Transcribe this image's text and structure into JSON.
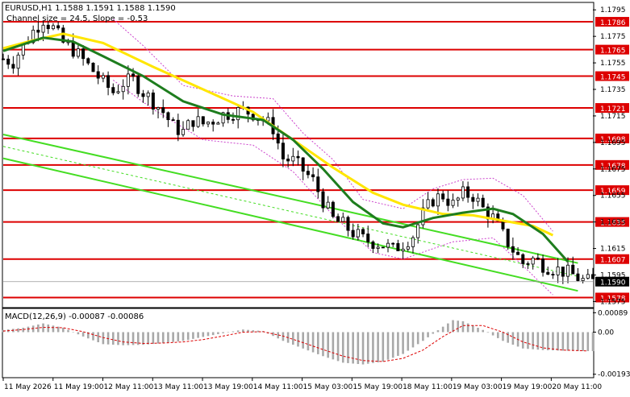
{
  "header": {
    "symbol_line": "EURUSD,H1  1.1588 1.1591 1.1588 1.1590",
    "channel_line": "Channel size = 24.5, Slope = -0.53"
  },
  "macd": {
    "label": "MACD(12,26,9) -0.00087 -0.00086",
    "ticks": [
      {
        "value": 0.00089,
        "label": "0.00089"
      },
      {
        "value": 0.0,
        "label": "0.00"
      },
      {
        "value": -0.00193,
        "label": "-0.00193"
      }
    ],
    "ylim": [
      -0.00205,
      0.00105
    ]
  },
  "price_axis": {
    "ylim": [
      1.1571,
      1.18
    ],
    "ticks": [
      {
        "value": 1.1795,
        "label": "1.1795"
      },
      {
        "value": 1.1775,
        "label": "1.1775"
      },
      {
        "value": 1.1755,
        "label": "1.1755"
      },
      {
        "value": 1.1735,
        "label": "1.1735"
      },
      {
        "value": 1.1715,
        "label": "1.1715"
      },
      {
        "value": 1.1695,
        "label": "1.1695"
      },
      {
        "value": 1.1675,
        "label": "1.1675"
      },
      {
        "value": 1.1655,
        "label": "1.1655"
      },
      {
        "value": 1.1635,
        "label": "1.1635"
      },
      {
        "value": 1.1615,
        "label": "1.1615"
      },
      {
        "value": 1.1595,
        "label": "1.1595"
      },
      {
        "value": 1.1575,
        "label": "1.1575"
      }
    ],
    "current_price": {
      "value": 1.159,
      "label": "1.1590"
    }
  },
  "time_axis": {
    "labels": [
      "11 May 2026",
      "11 May 19:00",
      "12 May 11:00",
      "13 May 11:00",
      "13 May 19:00",
      "14 May 11:00",
      "15 May 03:00",
      "15 May 19:00",
      "18 May 11:00",
      "19 May 03:00",
      "19 May 19:00",
      "20 May 11:00"
    ],
    "x_range": [
      0,
      118
    ]
  },
  "colors": {
    "level": "#dd0000",
    "candle": "#000000",
    "ma_fast": "#1e7d1e",
    "ma_slow": "#ffe600",
    "channel": "#44dd22",
    "envelope": "#cc44cc",
    "macd_hist": "#a8a8a8",
    "macd_signal": "#dd0000",
    "grid_text": "#000000"
  },
  "chart_data": {
    "type": "candlestick",
    "title": "EURUSD,H1",
    "horizontal_levels": [
      {
        "value": 1.1786,
        "label": "1.1786"
      },
      {
        "value": 1.1765,
        "label": "1.1765"
      },
      {
        "value": 1.1745,
        "label": "1.1745"
      },
      {
        "value": 1.1721,
        "label": "1.1721"
      },
      {
        "value": 1.1698,
        "label": "1.1698"
      },
      {
        "value": 1.1678,
        "label": "1.1678"
      },
      {
        "value": 1.1659,
        "label": "1.1659"
      },
      {
        "value": 1.1635,
        "label": "1.1635"
      },
      {
        "value": 1.1607,
        "label": "1.1607"
      },
      {
        "value": 1.1578,
        "label": "1.1578"
      }
    ],
    "close_path": [
      [
        0,
        1.1758
      ],
      [
        2,
        1.1756
      ],
      [
        4,
        1.1768
      ],
      [
        6,
        1.1779
      ],
      [
        8,
        1.1788
      ],
      [
        10,
        1.1781
      ],
      [
        12,
        1.177
      ],
      [
        14,
        1.1765
      ],
      [
        16,
        1.1757
      ],
      [
        18,
        1.1749
      ],
      [
        20,
        1.174
      ],
      [
        22,
        1.1733
      ],
      [
        24,
        1.174
      ],
      [
        26,
        1.1742
      ],
      [
        28,
        1.1733
      ],
      [
        30,
        1.1726
      ],
      [
        32,
        1.1718
      ],
      [
        34,
        1.1707
      ],
      [
        36,
        1.1703
      ],
      [
        38,
        1.1712
      ],
      [
        40,
        1.1709
      ],
      [
        42,
        1.1712
      ],
      [
        44,
        1.1716
      ],
      [
        46,
        1.1718
      ],
      [
        48,
        1.1719
      ],
      [
        50,
        1.1717
      ],
      [
        52,
        1.1712
      ],
      [
        54,
        1.1706
      ],
      [
        56,
        1.1683
      ],
      [
        58,
        1.1681
      ],
      [
        60,
        1.1674
      ],
      [
        62,
        1.1666
      ],
      [
        64,
        1.1651
      ],
      [
        66,
        1.1637
      ],
      [
        68,
        1.1633
      ],
      [
        70,
        1.1627
      ],
      [
        72,
        1.1622
      ],
      [
        74,
        1.162
      ],
      [
        76,
        1.1618
      ],
      [
        78,
        1.1614
      ],
      [
        80,
        1.1619
      ],
      [
        82,
        1.1625
      ],
      [
        84,
        1.1641
      ],
      [
        86,
        1.1652
      ],
      [
        88,
        1.1655
      ],
      [
        90,
        1.1648
      ],
      [
        92,
        1.1656
      ],
      [
        94,
        1.1655
      ],
      [
        96,
        1.1645
      ],
      [
        98,
        1.1638
      ],
      [
        100,
        1.1625
      ],
      [
        102,
        1.1614
      ],
      [
        104,
        1.1604
      ],
      [
        106,
        1.1607
      ],
      [
        108,
        1.1603
      ],
      [
        110,
        1.16
      ],
      [
        112,
        1.1598
      ],
      [
        114,
        1.1595
      ],
      [
        116,
        1.1591
      ],
      [
        117,
        1.159
      ]
    ],
    "ma_fast": [
      [
        0,
        1.1764
      ],
      [
        8,
        1.1774
      ],
      [
        14,
        1.1771
      ],
      [
        20,
        1.176
      ],
      [
        28,
        1.1745
      ],
      [
        36,
        1.1726
      ],
      [
        44,
        1.1716
      ],
      [
        52,
        1.1712
      ],
      [
        58,
        1.1697
      ],
      [
        64,
        1.1675
      ],
      [
        70,
        1.165
      ],
      [
        76,
        1.1634
      ],
      [
        80,
        1.1631
      ],
      [
        86,
        1.1638
      ],
      [
        92,
        1.1642
      ],
      [
        98,
        1.1645
      ],
      [
        102,
        1.1641
      ],
      [
        108,
        1.1626
      ],
      [
        113,
        1.1605
      ]
    ],
    "ma_slow": [
      [
        0,
        1.1766
      ],
      [
        6,
        1.1772
      ],
      [
        12,
        1.1777
      ],
      [
        20,
        1.177
      ],
      [
        30,
        1.1752
      ],
      [
        40,
        1.1735
      ],
      [
        50,
        1.1718
      ],
      [
        58,
        1.1697
      ],
      [
        66,
        1.1676
      ],
      [
        74,
        1.1657
      ],
      [
        80,
        1.1648
      ],
      [
        88,
        1.1641
      ],
      [
        94,
        1.164
      ],
      [
        100,
        1.1636
      ],
      [
        106,
        1.1632
      ],
      [
        110,
        1.1625
      ]
    ],
    "channel_upper": [
      [
        0,
        1.1701
      ],
      [
        115,
        1.1604
      ]
    ],
    "channel_lower": [
      [
        0,
        1.1683
      ],
      [
        115,
        1.1583
      ]
    ],
    "channel_mid": [
      [
        0,
        1.1692
      ],
      [
        115,
        1.1594
      ]
    ],
    "envelope_upper": [
      [
        22,
        1.1788
      ],
      [
        28,
        1.1768
      ],
      [
        36,
        1.1738
      ],
      [
        46,
        1.173
      ],
      [
        54,
        1.1728
      ],
      [
        60,
        1.1702
      ],
      [
        66,
        1.1682
      ],
      [
        72,
        1.1652
      ],
      [
        80,
        1.1645
      ],
      [
        86,
        1.166
      ],
      [
        92,
        1.1667
      ],
      [
        98,
        1.1668
      ],
      [
        104,
        1.1655
      ],
      [
        110,
        1.1628
      ]
    ],
    "envelope_lower": [
      [
        22,
        1.1742
      ],
      [
        30,
        1.172
      ],
      [
        40,
        1.1697
      ],
      [
        50,
        1.1693
      ],
      [
        58,
        1.1673
      ],
      [
        66,
        1.164
      ],
      [
        74,
        1.1612
      ],
      [
        80,
        1.1607
      ],
      [
        90,
        1.162
      ],
      [
        98,
        1.1623
      ],
      [
        104,
        1.1602
      ],
      [
        110,
        1.158
      ]
    ],
    "macd": {
      "histogram": [
        [
          0,
          0.0001
        ],
        [
          4,
          0.0002
        ],
        [
          8,
          0.0004
        ],
        [
          12,
          0.0002
        ],
        [
          16,
          -0.0002
        ],
        [
          20,
          -0.00055
        ],
        [
          24,
          -0.0006
        ],
        [
          28,
          -0.00058
        ],
        [
          32,
          -0.0005
        ],
        [
          36,
          -0.0004
        ],
        [
          40,
          -0.00022
        ],
        [
          44,
          -5e-05
        ],
        [
          48,
          0.00012
        ],
        [
          52,
          5e-05
        ],
        [
          56,
          -0.0004
        ],
        [
          60,
          -0.00075
        ],
        [
          64,
          -0.0011
        ],
        [
          68,
          -0.0014
        ],
        [
          72,
          -0.00148
        ],
        [
          76,
          -0.00135
        ],
        [
          80,
          -0.001
        ],
        [
          84,
          -0.0004
        ],
        [
          88,
          0.00025
        ],
        [
          90,
          0.00055
        ],
        [
          92,
          0.0005
        ],
        [
          96,
          0.0001
        ],
        [
          100,
          -0.0004
        ],
        [
          104,
          -0.00075
        ],
        [
          108,
          -0.00082
        ],
        [
          112,
          -0.00085
        ],
        [
          117,
          -0.00087
        ]
      ],
      "signal": [
        [
          0,
          5e-05
        ],
        [
          4,
          0.00012
        ],
        [
          8,
          0.00022
        ],
        [
          12,
          0.0002
        ],
        [
          16,
          2e-05
        ],
        [
          20,
          -0.00025
        ],
        [
          24,
          -0.00045
        ],
        [
          28,
          -0.00052
        ],
        [
          32,
          -0.0005
        ],
        [
          36,
          -0.00045
        ],
        [
          40,
          -0.00034
        ],
        [
          44,
          -0.00018
        ],
        [
          48,
          0.0
        ],
        [
          52,
          2e-05
        ],
        [
          56,
          -0.00018
        ],
        [
          60,
          -0.00048
        ],
        [
          64,
          -0.0008
        ],
        [
          68,
          -0.0011
        ],
        [
          72,
          -0.0013
        ],
        [
          76,
          -0.00135
        ],
        [
          80,
          -0.0012
        ],
        [
          84,
          -0.00082
        ],
        [
          88,
          -0.0002
        ],
        [
          92,
          0.0003
        ],
        [
          96,
          0.0003
        ],
        [
          100,
          0.0
        ],
        [
          104,
          -0.00045
        ],
        [
          108,
          -0.00072
        ],
        [
          112,
          -0.00082
        ],
        [
          117,
          -0.00086
        ]
      ]
    }
  }
}
